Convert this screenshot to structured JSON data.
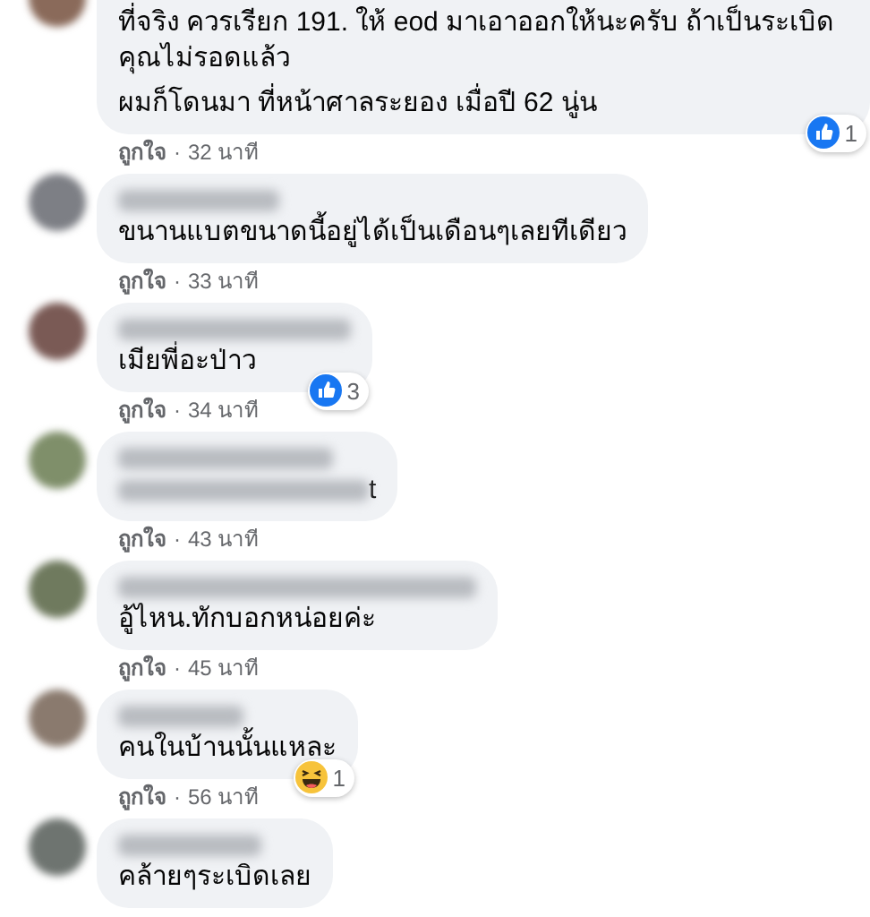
{
  "comments": [
    {
      "kind": "continued",
      "paragraphs": [
        "ที่จริง ควรเรียก 191. ให้ eod มาเอาออกให้นะครับ ถ้าเป็นระเบิด คุณไม่รอดแล้ว",
        "ผมก็โดนมา ที่หน้าศาลระยอง เมื่อปี 62 นู่น"
      ],
      "reaction": {
        "kind": "like",
        "count": "1"
      },
      "like": "ถูกใจ",
      "separator": "·",
      "time": "32 นาที"
    },
    {
      "kind": "normal",
      "paragraphs": [
        "ขนานแบตขนาดนี้อยู่ได้เป็นเดือนๆเลยทีเดียว"
      ],
      "like": "ถูกใจ",
      "separator": "·",
      "time": "33 นาที"
    },
    {
      "kind": "normal",
      "paragraphs": [
        "เมียพี่อะป่าว"
      ],
      "reaction": {
        "kind": "like",
        "count": "3"
      },
      "like": "ถูกใจ",
      "separator": "·",
      "time": "34 นาที"
    },
    {
      "kind": "redacted",
      "fragment": "t",
      "like": "ถูกใจ",
      "separator": "·",
      "time": "43 นาที"
    },
    {
      "kind": "normal",
      "paragraphs": [
        "อู้ไหน.ทักบอกหน่อยค่ะ"
      ],
      "like": "ถูกใจ",
      "separator": "·",
      "time": "45 นาที"
    },
    {
      "kind": "normal",
      "paragraphs": [
        "คนในบ้านนั้นแหละ"
      ],
      "reaction": {
        "kind": "haha",
        "count": "1"
      },
      "like": "ถูกใจ",
      "separator": "·",
      "time": "56 นาที"
    },
    {
      "kind": "normal",
      "paragraphs": [
        "คล้ายๆระเบิดเลย"
      ]
    }
  ]
}
